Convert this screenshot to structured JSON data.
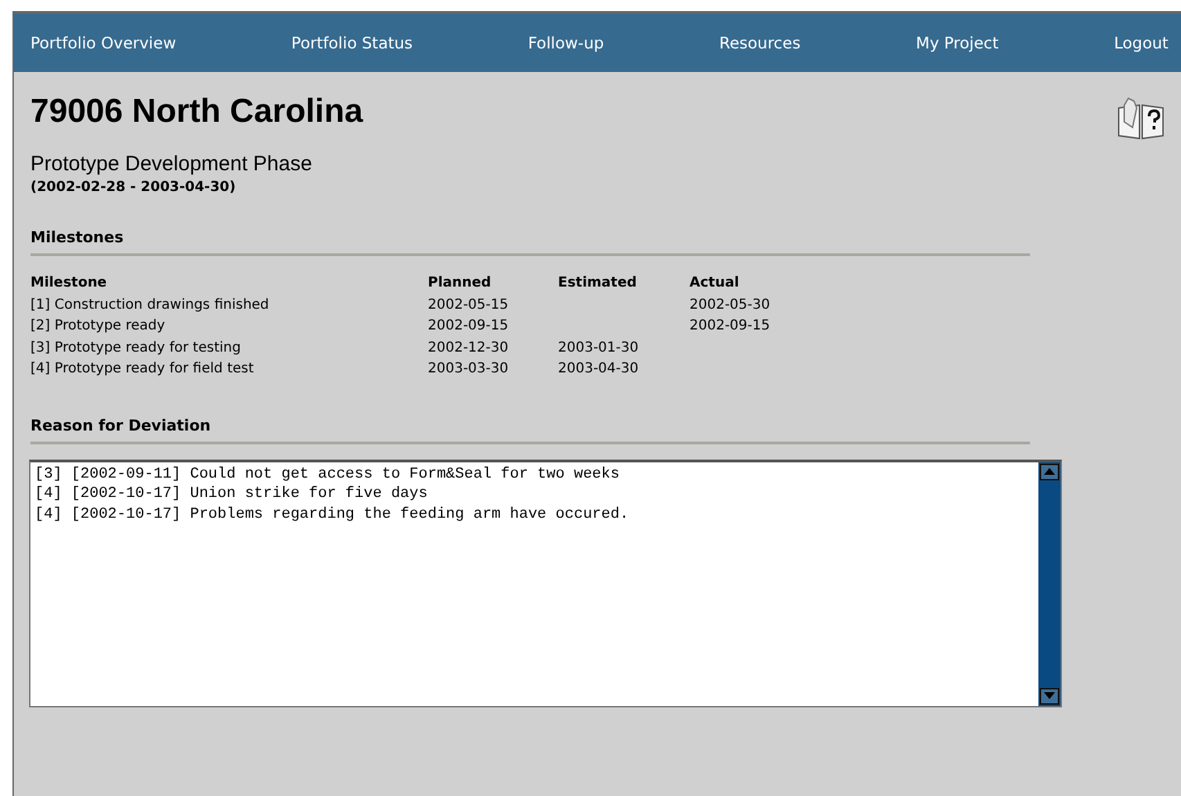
{
  "nav": [
    {
      "label": "Portfolio Overview"
    },
    {
      "label": "Portfolio Status"
    },
    {
      "label": "Follow-up"
    },
    {
      "label": "Resources"
    },
    {
      "label": "My Project"
    },
    {
      "label": "Logout"
    }
  ],
  "title": "79006 North Carolina",
  "phase": {
    "name": "Prototype Development Phase",
    "period": "(2002-02-28 - 2003-04-30)"
  },
  "milestones": {
    "heading": "Milestones",
    "columns": [
      "Milestone",
      "Planned",
      "Estimated",
      "Actual"
    ],
    "rows": [
      [
        "[1] Construction drawings finished",
        "2002-05-15",
        "",
        "2002-05-30"
      ],
      [
        "[2] Prototype ready",
        "2002-09-15",
        "",
        "2002-09-15"
      ],
      [
        "[3] Prototype ready for testing",
        "2002-12-30",
        "2003-01-30",
        ""
      ],
      [
        "[4] Prototype ready for field test",
        "2003-03-30",
        "2003-04-30",
        ""
      ]
    ]
  },
  "deviation": {
    "heading": "Reason for Deviation",
    "lines": [
      "[3] [2002-09-11] Could not get access to Form&Seal for two weeks",
      "[4] [2002-10-17] Union strike for five days",
      "[4] [2002-10-17] Problems regarding the feeding arm have occured."
    ]
  }
}
